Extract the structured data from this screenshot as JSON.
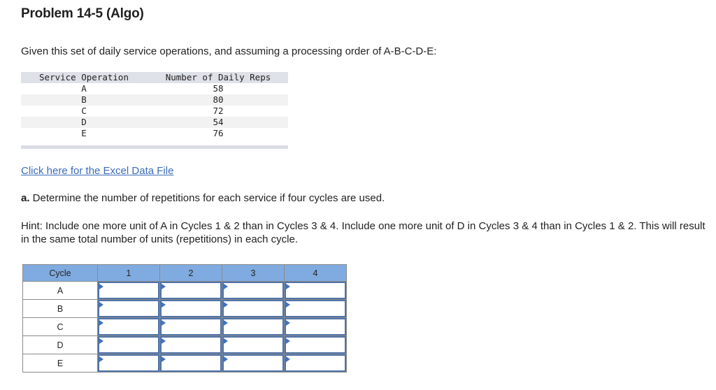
{
  "problem": {
    "title": "Problem 14-5 (Algo)",
    "intro": "Given this set of daily service operations, and assuming a processing order of A-B-C-D-E:"
  },
  "data_table": {
    "headers": [
      "Service Operation",
      "Number of Daily Reps"
    ],
    "rows": [
      {
        "operation": "A",
        "reps": "58"
      },
      {
        "operation": "B",
        "reps": "80"
      },
      {
        "operation": "C",
        "reps": "72"
      },
      {
        "operation": "D",
        "reps": "54"
      },
      {
        "operation": "E",
        "reps": "76"
      }
    ]
  },
  "excel_link": {
    "label": "Click here for the Excel Data File",
    "color": "#3b6cb7"
  },
  "question": {
    "prefix": "a.",
    "text": " Determine the number of repetitions for each service if four cycles are used."
  },
  "hint": {
    "text": "Hint: Include one more unit of A in Cycles 1 & 2 than in Cycles 3 & 4. Include one more unit of D in Cycles 3 & 4 than in Cycles 1 & 2. This will result in the same total number of units (repetitions) in each cycle."
  },
  "answer_grid": {
    "header_label": "Cycle",
    "columns": [
      "1",
      "2",
      "3",
      "4"
    ],
    "rows": [
      {
        "label": "A",
        "values": [
          "",
          "",
          "",
          ""
        ]
      },
      {
        "label": "B",
        "values": [
          "",
          "",
          "",
          ""
        ]
      },
      {
        "label": "C",
        "values": [
          "",
          "",
          "",
          ""
        ]
      },
      {
        "label": "D",
        "values": [
          "",
          "",
          "",
          ""
        ]
      },
      {
        "label": "E",
        "values": [
          "",
          "",
          "",
          ""
        ]
      }
    ],
    "header_color": "#80abe0",
    "input_border_color": "#4f73a8",
    "flag_color": "#3f72c0"
  }
}
